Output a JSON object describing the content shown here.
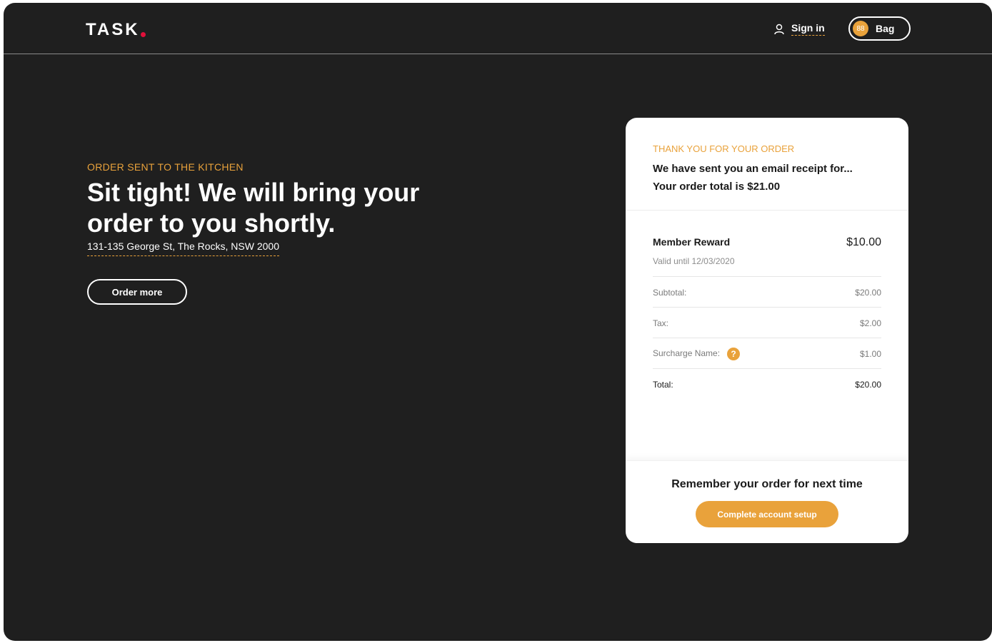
{
  "header": {
    "logo": "TASK",
    "sign_in": "Sign in",
    "bag_count": "88",
    "bag_label": "Bag"
  },
  "hero": {
    "eyebrow": "ORDER SENT TO THE KITCHEN",
    "headline": "Sit tight! We will bring your order to you shortly.",
    "address": "131-135 George St, The Rocks, NSW 2000",
    "order_more": "Order more"
  },
  "receipt": {
    "eyebrow": "THANK YOU FOR YOUR ORDER",
    "line1": "We have sent you an email receipt for...",
    "line2": "Your order total is $21.00",
    "reward": {
      "label": "Member Reward",
      "valid": "Valid until 12/03/2020",
      "amount": "$10.00"
    },
    "rows": [
      {
        "label": "Subtotal:",
        "value": "$20.00"
      },
      {
        "label": "Tax:",
        "value": "$2.00"
      },
      {
        "label": "Surcharge Name:",
        "value": "$1.00",
        "help": "?"
      },
      {
        "label": "Total:",
        "value": "$20.00"
      }
    ],
    "footer": {
      "title": "Remember your order for next time",
      "button": "Complete account setup"
    }
  },
  "colors": {
    "accent": "#e9a23b",
    "logo_dot": "#e0103a",
    "background": "#1f1f1f"
  }
}
